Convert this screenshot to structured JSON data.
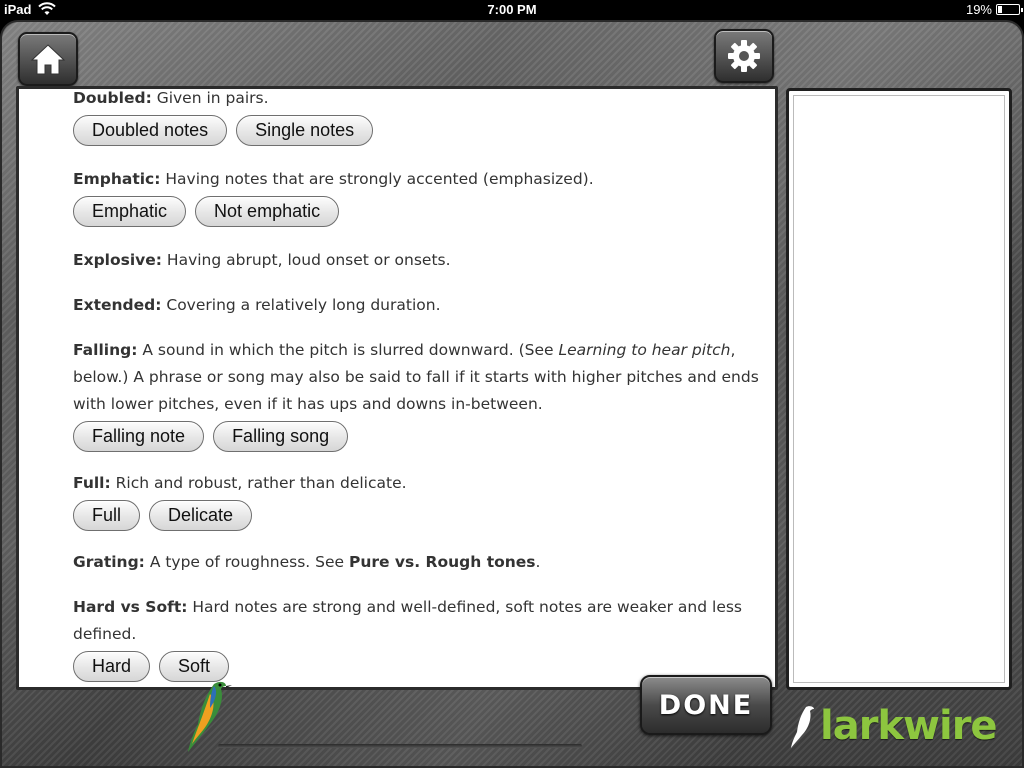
{
  "status_bar": {
    "carrier": "iPad",
    "time": "7:00 PM",
    "battery": "19%"
  },
  "toolbar": {
    "home_icon": "home-icon",
    "settings_icon": "gear-icon"
  },
  "entries": [
    {
      "term": "Doubled:",
      "definition": " Given in pairs.",
      "buttons": [
        "Doubled notes",
        "Single notes"
      ]
    },
    {
      "term": "Emphatic:",
      "definition": " Having notes that are strongly accented (emphasized).",
      "buttons": [
        "Emphatic",
        "Not emphatic"
      ]
    },
    {
      "term": "Explosive:",
      "definition": " Having abrupt, loud onset or onsets.",
      "buttons": []
    },
    {
      "term": "Extended:",
      "definition": " Covering a relatively long duration.",
      "buttons": []
    },
    {
      "term": "Falling:",
      "definition_pre": " A sound in which the pitch is slurred downward. (See ",
      "definition_link": "Learning to hear pitch",
      "definition_post": ", below.) A phrase or song may also be said to fall if it starts with higher pitches and ends with lower pitches, even if it has ups and downs in-between.",
      "buttons": [
        "Falling note",
        "Falling song"
      ]
    },
    {
      "term": "Full:",
      "definition": " Rich and robust, rather than delicate.",
      "buttons": [
        "Full",
        "Delicate"
      ]
    },
    {
      "term": "Grating:",
      "definition_pre": " A type of roughness. See ",
      "definition_ref": "Pure vs. Rough tones",
      "definition_post": ".",
      "buttons": []
    },
    {
      "term": "Hard vs Soft:",
      "definition": " Hard notes are strong and well-defined, soft notes are weaker and less defined.",
      "buttons": [
        "Hard",
        "Soft"
      ]
    }
  ],
  "bottom_bar": {
    "done_label": "DONE",
    "brand": "larkwire"
  },
  "colors": {
    "brand_green": "#8dc63f",
    "frame_metal": "#555555"
  }
}
